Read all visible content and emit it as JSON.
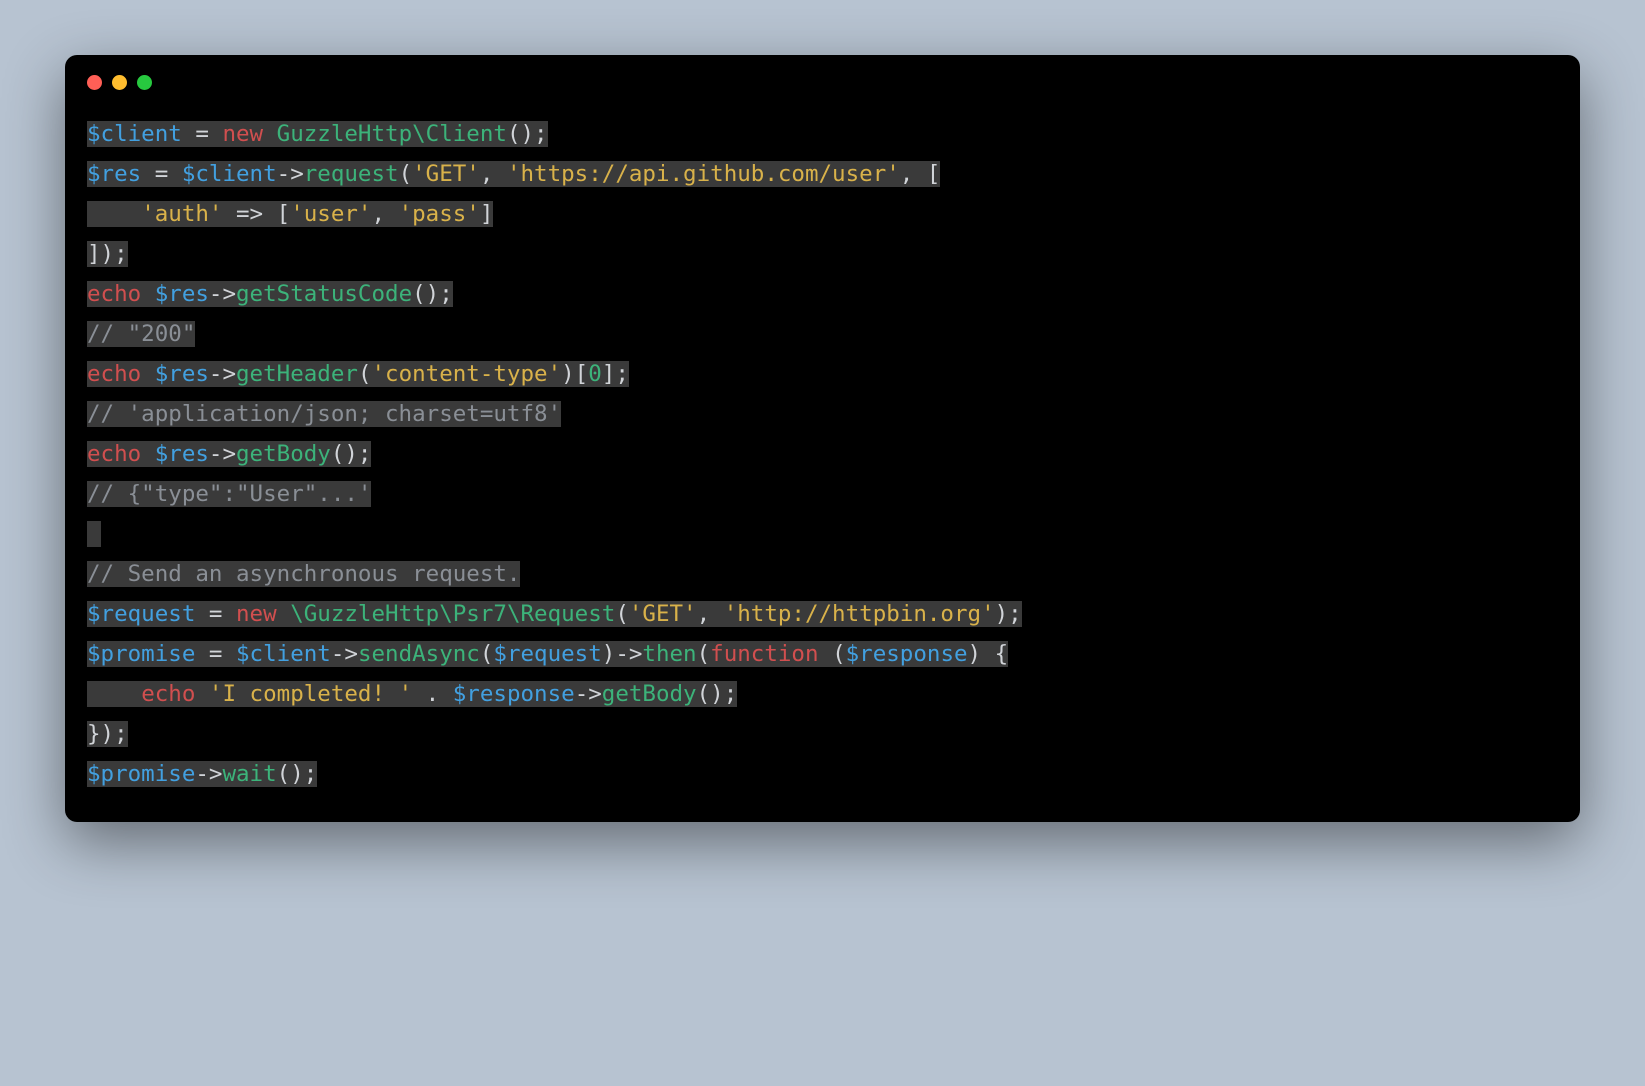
{
  "code": {
    "l1": {
      "var1": "$client",
      "eq": " = ",
      "kw": "new",
      "sp": " ",
      "cls": "GuzzleHttp\\Client",
      "p1": "();"
    },
    "l2": {
      "var1": "$res",
      "eq": " = ",
      "var2": "$client",
      "arr": "->",
      "fn": "request",
      "p1": "(",
      "s1": "'GET'",
      "c1": ", ",
      "s2": "'https://api.github.com/user'",
      "c2": ", ["
    },
    "l3": {
      "indent": "    ",
      "s1": "'auth'",
      "arr": " => ",
      "p1": "[",
      "s2": "'user'",
      "c1": ", ",
      "s3": "'pass'",
      "p2": "]"
    },
    "l4": {
      "p1": "]);"
    },
    "l5": {
      "kw": "echo",
      "sp": " ",
      "var1": "$res",
      "arr": "->",
      "fn": "getStatusCode",
      "p1": "();"
    },
    "l6": {
      "cm": "// \"200\""
    },
    "l7": {
      "kw": "echo",
      "sp": " ",
      "var1": "$res",
      "arr": "->",
      "fn": "getHeader",
      "p1": "(",
      "s1": "'content-type'",
      "p2": ")[",
      "n1": "0",
      "p3": "];"
    },
    "l8": {
      "cm": "// 'application/json; charset=utf8'"
    },
    "l9": {
      "kw": "echo",
      "sp": " ",
      "var1": "$res",
      "arr": "->",
      "fn": "getBody",
      "p1": "();"
    },
    "l10": {
      "cm": "// {\"type\":\"User\"...'"
    },
    "l11": {
      "blank": " "
    },
    "l12": {
      "cm": "// Send an asynchronous request."
    },
    "l13": {
      "var1": "$request",
      "eq": " = ",
      "kw": "new",
      "sp": " ",
      "cls": "\\GuzzleHttp\\Psr7\\Request",
      "p1": "(",
      "s1": "'GET'",
      "c1": ", ",
      "s2": "'http://httpbin.org'",
      "p2": ");"
    },
    "l14": {
      "var1": "$promise",
      "eq": " = ",
      "var2": "$client",
      "arr1": "->",
      "fn1": "sendAsync",
      "p1": "(",
      "var3": "$request",
      "p2": ")",
      "arr2": "->",
      "fn2": "then",
      "p3": "(",
      "kw": "function",
      "sp": " ",
      "p4": "(",
      "var4": "$response",
      "p5": ") {"
    },
    "l15": {
      "indent": "    ",
      "kw": "echo",
      "sp": " ",
      "s1": "'I completed! '",
      "dot": " . ",
      "var1": "$response",
      "arr": "->",
      "fn": "getBody",
      "p1": "();"
    },
    "l16": {
      "p1": "});"
    },
    "l17": {
      "var1": "$promise",
      "arr": "->",
      "fn": "wait",
      "p1": "();"
    }
  }
}
